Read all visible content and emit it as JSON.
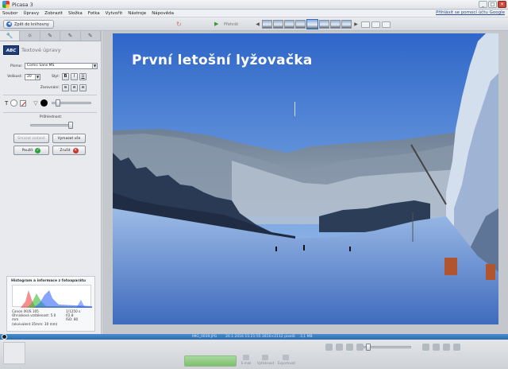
{
  "window": {
    "title": "Picasa 3",
    "minimize": "_",
    "maximize": "□",
    "close": "×"
  },
  "menu": {
    "items": [
      "Soubor",
      "Úpravy",
      "Zobrazit",
      "Složka",
      "Fotka",
      "Vytvořit",
      "Nástroje",
      "Nápověda"
    ],
    "signin_link": "Přihlásit se pomocí účtu Google"
  },
  "toolbar": {
    "back_label": "Zpět do knihovny",
    "play_label": "Přehrát"
  },
  "panel": {
    "title": "Textové úpravy",
    "icon_text": "ABC",
    "font_label": "Písmo:",
    "font_value": "Comic Sans MS",
    "size_label": "Velikost:",
    "size_value": "20",
    "style_label": "Styl:",
    "bold": "B",
    "italic": "I",
    "underline": "U",
    "align_label": "Zarovnání:",
    "transparency_label": "Průhlednost:",
    "transparency_level": 0.9,
    "btn_delete": "Smazat zadané",
    "btn_clear": "Vymazat vše",
    "btn_apply": "Použít",
    "btn_cancel": "Zrušit"
  },
  "histogram": {
    "title": "Histogram a informace z fotoaparátu",
    "camera": "Canon IXUS 105",
    "focal": "Ohnisková vzdálenost: 5.0",
    "mm": "mm",
    "equiv": "(ekvivalent 35mm: 30 mm)",
    "shutter": "1/1250 s",
    "fstop": "f/2.8",
    "iso": "ISO: 80"
  },
  "photo": {
    "caption": "První letošní lyžovačka"
  },
  "status": {
    "filename": "IMG_0039.JPG",
    "date": "20.1.2016 15:21:55",
    "dimensions": "2816×2112 pixelů",
    "size": "3,1 MB"
  },
  "tray": {
    "email": "E-mail",
    "print": "Vytisknout",
    "export": "Exportovat"
  },
  "colors": {
    "accent": "#2f6bc4",
    "status_bar": "#3b7fc4",
    "ok": "#2f9e3c",
    "cancel": "#c9332b"
  }
}
